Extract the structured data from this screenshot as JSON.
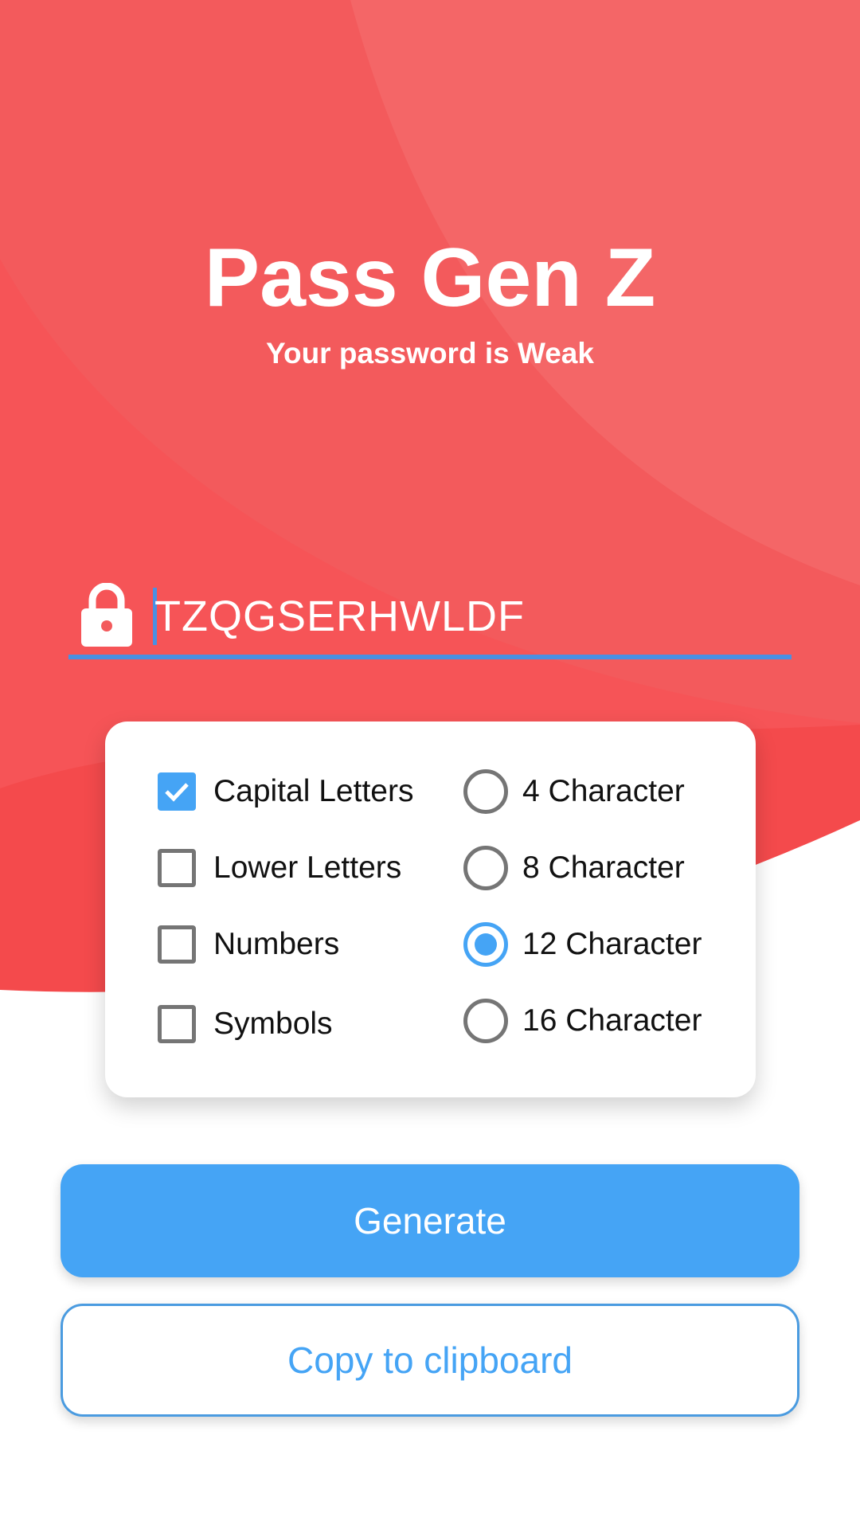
{
  "app": {
    "title": "Pass Gen Z",
    "strength_text": "Your password is Weak"
  },
  "password": {
    "value": "TZQGSERHWLDF",
    "icon": "lock-icon"
  },
  "options": {
    "character_types": [
      {
        "label": "Capital Letters",
        "checked": true
      },
      {
        "label": "Lower Letters",
        "checked": false
      },
      {
        "label": "Numbers",
        "checked": false
      },
      {
        "label": "Symbols",
        "checked": false
      }
    ],
    "lengths": [
      {
        "label": "4 Character",
        "selected": false
      },
      {
        "label": "8 Character",
        "selected": false
      },
      {
        "label": "12 Character",
        "selected": true
      },
      {
        "label": "16 Character",
        "selected": false
      }
    ]
  },
  "actions": {
    "generate_label": "Generate",
    "copy_label": "Copy to clipboard"
  },
  "colors": {
    "background_red": "#f44a4c",
    "accent_blue": "#45a4f5",
    "underline_blue": "#4a90e2"
  }
}
